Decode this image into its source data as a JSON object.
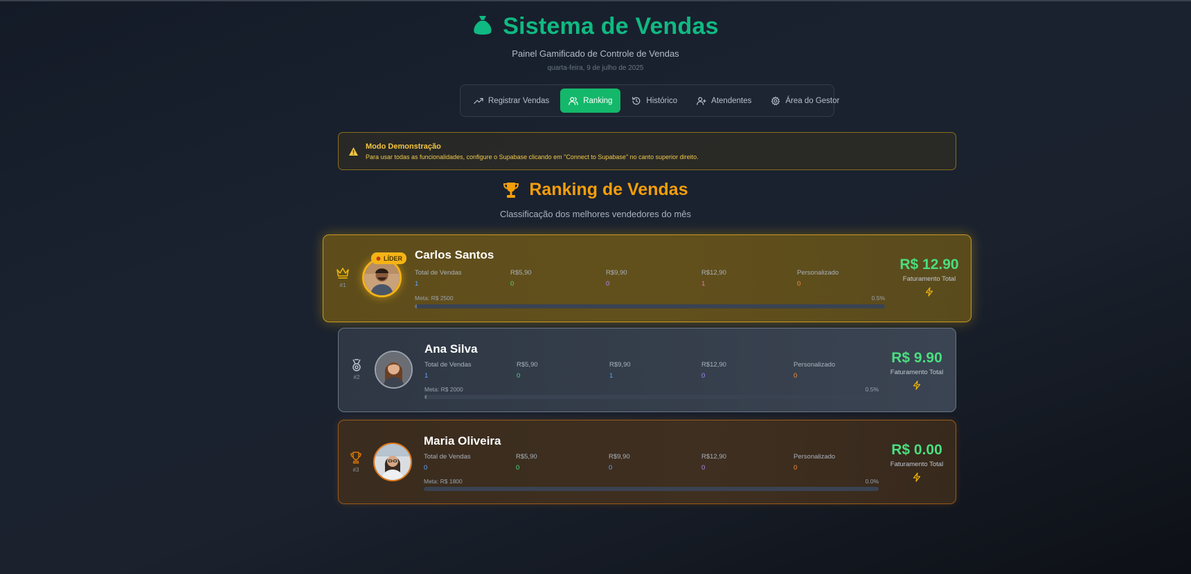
{
  "header": {
    "title": "Sistema de Vendas",
    "subtitle": "Painel Gamificado de Controle de Vendas",
    "date": "quarta-feira, 9 de julho de 2025",
    "icon": "money-bag-icon",
    "title_color": "#10b981"
  },
  "nav": {
    "tabs": [
      {
        "label": "Registrar Vendas",
        "icon": "trending-up-icon",
        "active": false
      },
      {
        "label": "Ranking",
        "icon": "users-icon",
        "active": true
      },
      {
        "label": "Histórico",
        "icon": "history-icon",
        "active": false
      },
      {
        "label": "Atendentes",
        "icon": "user-plus-icon",
        "active": false
      },
      {
        "label": "Área do Gestor",
        "icon": "gear-icon",
        "active": false
      }
    ],
    "active_color": "#14b86a"
  },
  "alert": {
    "title": "Modo Demonstração",
    "text": "Para usar todas as funcionalidades, configure o Supabase clicando em \"Connect to Supabase\" no canto superior direito."
  },
  "ranking": {
    "title": "Ranking de Vendas",
    "subtitle": "Classificação dos melhores vendedores do mês",
    "leader_badge": "LÍDER",
    "stat_labels": {
      "total": "Total de Vendas",
      "p590": "R$5,90",
      "p990": "R$9,90",
      "p1290": "R$12,90",
      "custom": "Personalizado"
    },
    "revenue_label": "Faturamento Total",
    "sellers": [
      {
        "rank": "#1",
        "name": "Carlos Santos",
        "total": "1",
        "p590": "0",
        "p990": "0",
        "p1290": "1",
        "custom": "0",
        "meta": "Meta: R$ 2500",
        "percent": "0.5%",
        "progress": 0.005,
        "revenue": "R$ 12.90"
      },
      {
        "rank": "#2",
        "name": "Ana Silva",
        "total": "1",
        "p590": "0",
        "p990": "1",
        "p1290": "0",
        "custom": "0",
        "meta": "Meta: R$ 2000",
        "percent": "0.5%",
        "progress": 0.005,
        "revenue": "R$ 9.90"
      },
      {
        "rank": "#3",
        "name": "Maria Oliveira",
        "total": "0",
        "p590": "0",
        "p990": "0",
        "p1290": "0",
        "custom": "0",
        "meta": "Meta: R$ 1800",
        "percent": "0.0%",
        "progress": 0.0,
        "revenue": "R$ 0.00"
      }
    ]
  }
}
